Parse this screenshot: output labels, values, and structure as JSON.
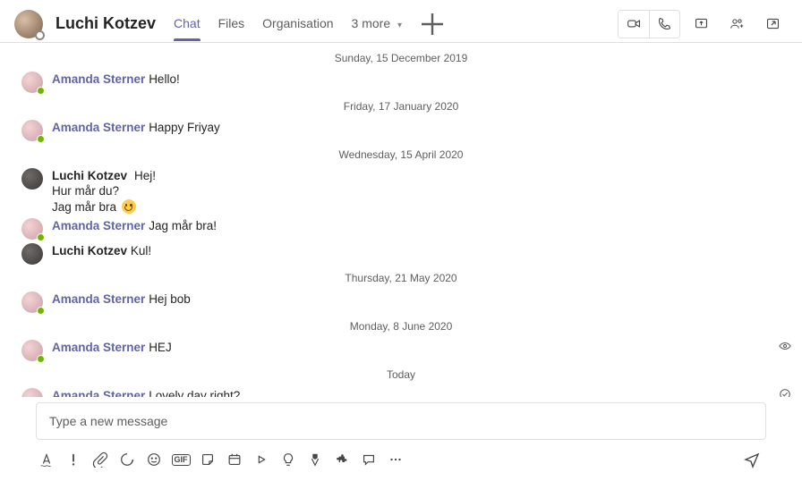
{
  "header": {
    "contact_name": "Luchi Kotzev",
    "tabs": {
      "chat": "Chat",
      "files": "Files",
      "organisation": "Organisation",
      "more": "3 more"
    }
  },
  "dates": {
    "d1": "Sunday, 15 December 2019",
    "d2": "Friday, 17 January 2020",
    "d3": "Wednesday, 15 April 2020",
    "d4": "Thursday, 21 May 2020",
    "d5": "Monday, 8 June 2020",
    "d6": "Today"
  },
  "messages": {
    "m1": {
      "sender": "Amanda Sterner",
      "text": "Hello!"
    },
    "m2": {
      "sender": "Amanda Sterner",
      "text": "Happy Friyay"
    },
    "m3": {
      "sender": "Luchi Kotzev",
      "line1": "Hej!",
      "line2": "Hur mår du?",
      "line3": "Jag mår bra "
    },
    "m4": {
      "sender": "Amanda Sterner",
      "text": "Jag mår bra!"
    },
    "m5": {
      "sender": "Luchi Kotzev",
      "text": "Kul!"
    },
    "m6": {
      "sender": "Amanda Sterner",
      "text": "Hej bob"
    },
    "m7": {
      "sender": "Amanda Sterner",
      "text": "HEJ"
    },
    "m8": {
      "sender": "Amanda Sterner",
      "text": "Lovely day right?"
    }
  },
  "compose": {
    "placeholder": "Type a new message"
  }
}
